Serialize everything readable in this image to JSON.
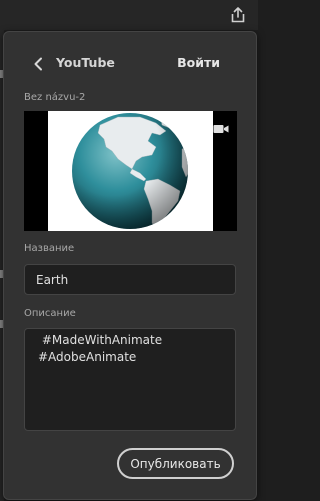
{
  "header": {
    "service": "YouTube",
    "login_label": "Войти"
  },
  "document": {
    "name": "Bez názvu-2"
  },
  "fields": {
    "title_label": "Название",
    "title_value": "Earth",
    "description_label": "Описание",
    "description_value": " #MadeWithAnimate\n#AdobeAnimate"
  },
  "actions": {
    "publish_label": "Опубликовать"
  },
  "colors": {
    "panel_bg": "#323232",
    "input_bg": "#1f1f1f",
    "globe_ocean": "#2f8f9c",
    "globe_land": "#e8ecee"
  },
  "icons": [
    "share-icon",
    "back-chevron-icon",
    "video-camera-icon",
    "earth-globe-image"
  ]
}
